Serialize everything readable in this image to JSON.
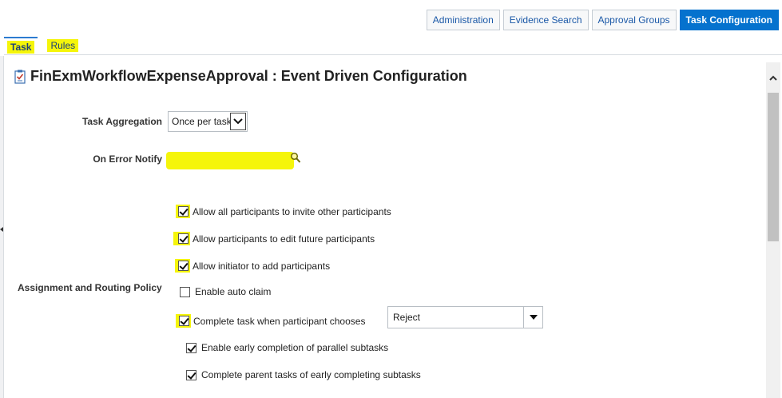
{
  "topnav": {
    "administration": "Administration",
    "evidence_search": "Evidence Search",
    "approval_groups": "Approval Groups",
    "task_configuration": "Task Configuration"
  },
  "tabs": {
    "task": "Task",
    "rules": "Rules"
  },
  "page": {
    "title": "FinExmWorkflowExpenseApproval : Event Driven Configuration"
  },
  "form": {
    "task_aggregation": {
      "label": "Task Aggregation",
      "value": "Once per task"
    },
    "on_error_notify": {
      "label": "On Error Notify"
    },
    "assignment_routing_policy": {
      "label": "Assignment and Routing Policy",
      "options": {
        "invite_participants": {
          "label": "Allow all participants to invite other participants",
          "checked": true
        },
        "edit_future": {
          "label": "Allow participants to edit future participants",
          "checked": true
        },
        "initiator_add": {
          "label": "Allow initiator to add participants",
          "checked": true
        },
        "auto_claim": {
          "label": "Enable auto claim",
          "checked": false
        },
        "complete_when_chooses": {
          "label": "Complete task when participant chooses",
          "checked": true,
          "choice": "Reject"
        },
        "early_completion": {
          "label": "Enable early completion of parallel subtasks",
          "checked": true
        },
        "complete_parent": {
          "label": "Complete parent tasks of early completing subtasks",
          "checked": true
        }
      }
    }
  },
  "colors": {
    "accent": "#0572ce",
    "highlight": "#f5f50a",
    "link": "#1a58a7"
  }
}
